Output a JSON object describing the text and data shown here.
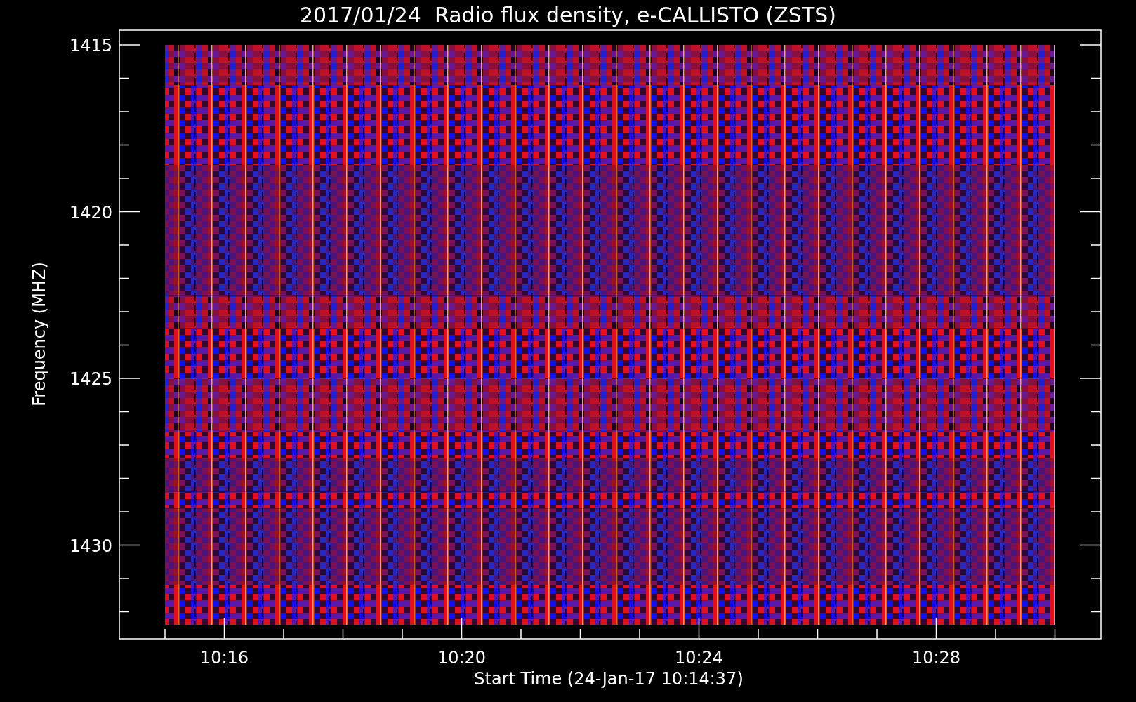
{
  "title": "2017/01/24  Radio flux density, e-CALLISTO (ZSTS)",
  "y_axis": {
    "label": "Frequency (MHZ)",
    "ticks": [
      "1415",
      "1420",
      "1425",
      "1430"
    ]
  },
  "x_axis": {
    "label": "Start Time (24-Jan-17 10:14:37)",
    "ticks": [
      "10:16",
      "10:20",
      "10:24",
      "10:28"
    ]
  }
}
